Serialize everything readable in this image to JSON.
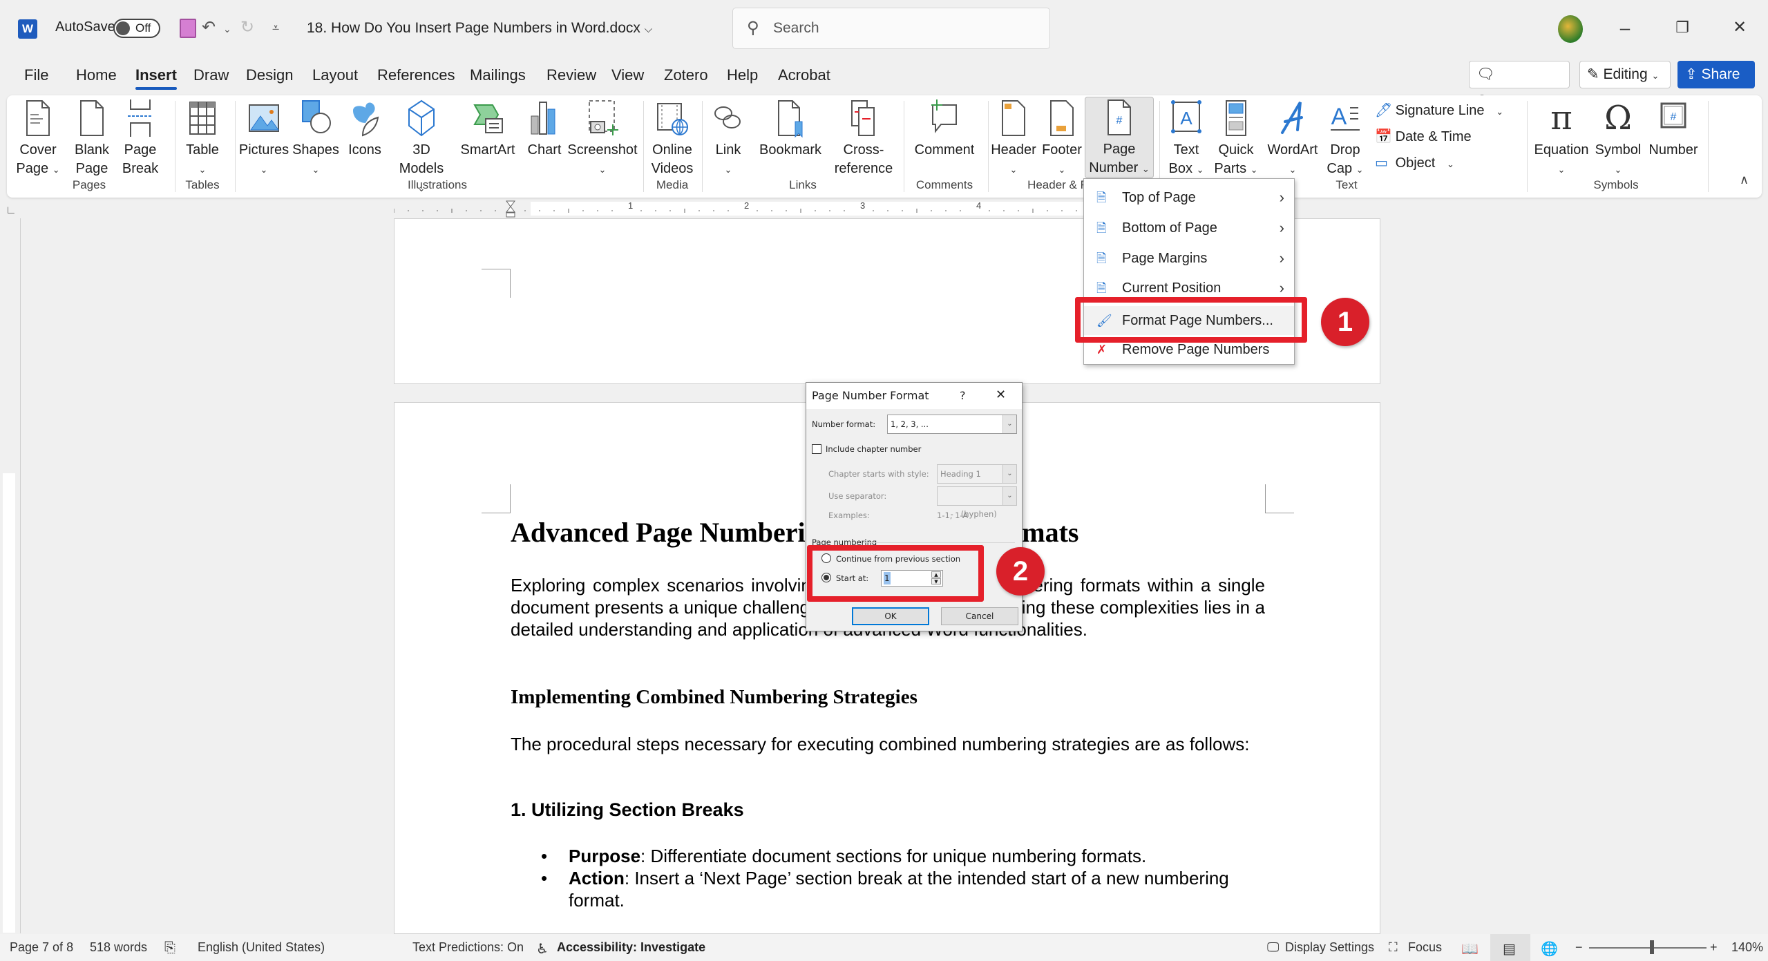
{
  "titlebar": {
    "app_icon": "word-icon",
    "app_letter": "W",
    "autosave_label": "AutoSave",
    "autosave_state": "Off",
    "doc_title": "18. How Do You Insert Page Numbers in Word.docx",
    "search_placeholder": "Search",
    "window_controls": {
      "minimize": "–",
      "restore": "❐",
      "close": "✕"
    }
  },
  "tabs": [
    "File",
    "Home",
    "Insert",
    "Draw",
    "Design",
    "Layout",
    "References",
    "Mailings",
    "Review",
    "View",
    "Zotero",
    "Help",
    "Acrobat"
  ],
  "active_tab": "Insert",
  "header_buttons": {
    "comments": "Comments",
    "editing": "Editing",
    "share": "Share"
  },
  "ribbon": {
    "groups": {
      "pages": "Pages",
      "tables": "Tables",
      "illustrations": "Illustrations",
      "media": "Media",
      "links": "Links",
      "comments": "Comments",
      "header_footer": "Header & F",
      "text": "Text",
      "symbols": "Symbols"
    },
    "buttons": {
      "cover_page": [
        "Cover",
        "Page"
      ],
      "blank_page": [
        "Blank",
        "Page"
      ],
      "page_break": [
        "Page",
        "Break"
      ],
      "table": [
        "Table",
        ""
      ],
      "pictures": [
        "Pictures",
        ""
      ],
      "shapes": [
        "Shapes",
        ""
      ],
      "icons": [
        "Icons",
        ""
      ],
      "models_3d": [
        "3D",
        "Models"
      ],
      "smartart": [
        "SmartArt",
        ""
      ],
      "chart": [
        "Chart",
        ""
      ],
      "screenshot": [
        "Screenshot",
        ""
      ],
      "online_videos": [
        "Online",
        "Videos"
      ],
      "link": [
        "Link",
        ""
      ],
      "bookmark": [
        "Bookmark",
        ""
      ],
      "cross_reference": [
        "Cross-",
        "reference"
      ],
      "comment": [
        "Comment",
        ""
      ],
      "header": [
        "Header",
        ""
      ],
      "footer": [
        "Footer",
        ""
      ],
      "page_number": [
        "Page",
        "Number"
      ],
      "text_box": [
        "Text",
        "Box"
      ],
      "quick_parts": [
        "Quick",
        "Parts"
      ],
      "wordart": [
        "WordArt",
        ""
      ],
      "drop_cap": [
        "Drop",
        "Cap"
      ],
      "equation": [
        "Equation",
        ""
      ],
      "symbol": [
        "Symbol",
        ""
      ],
      "number": [
        "Number",
        ""
      ]
    },
    "small_buttons": {
      "signature_line": "Signature Line",
      "date_time": "Date & Time",
      "object": "Object"
    }
  },
  "ruler": {
    "numbers": [
      "1",
      "2",
      "3",
      "4"
    ]
  },
  "page_number_menu": {
    "items": [
      {
        "label": "Top of Page",
        "has_submenu": true
      },
      {
        "label": "Bottom of Page",
        "has_submenu": true
      },
      {
        "label": "Page Margins",
        "has_submenu": true
      },
      {
        "label": "Current Position",
        "has_submenu": true
      },
      {
        "label": "Format Page Numbers...",
        "has_submenu": false,
        "highlighted": true
      },
      {
        "label": "Remove Page Numbers",
        "has_submenu": false
      }
    ]
  },
  "annotations": {
    "step1": "1",
    "step2": "2",
    "color": "#e5202a"
  },
  "dialog": {
    "title": "Page Number Format",
    "help": "?",
    "close": "✕",
    "number_format_label": "Number format:",
    "number_format_value": "1, 2, 3, ...",
    "include_chapter_label": "Include chapter number",
    "include_chapter_checked": false,
    "chapter_style_label": "Chapter starts with style:",
    "chapter_style_value": "Heading 1",
    "separator_label": "Use separator:",
    "separator_value": "-   (hyphen)",
    "examples_label": "Examples:",
    "examples_value": "1-1, 1-A",
    "page_numbering_label": "Page numbering",
    "continue_label": "Continue from previous section",
    "continue_selected": false,
    "start_at_label": "Start at:",
    "start_at_selected": true,
    "start_at_value": "1",
    "ok": "OK",
    "cancel": "Cancel"
  },
  "document": {
    "h1": "Advanced Page Numbering for Diverse Formats",
    "p1": "Exploring complex scenarios involving the use of multiple numbering formats within a single document presents a unique challenge. The essence of addressing these complexities lies in a detailed understanding and application of advanced Word functionalities.",
    "h2": "Implementing Combined Numbering Strategies",
    "p2": "The procedural steps necessary for executing combined numbering strategies are as follows:",
    "h3": "1. Utilizing Section Breaks",
    "bullets": [
      {
        "term": "Purpose",
        "text": ": Differentiate document sections for unique numbering formats."
      },
      {
        "term": "Action",
        "text": ": Insert a ‘Next Page’ section break at the intended start of a new numbering format."
      }
    ]
  },
  "statusbar": {
    "page": "Page 7 of 8",
    "words": "518 words",
    "language": "English (United States)",
    "text_predictions": "Text Predictions: On",
    "accessibility": "Accessibility: Investigate",
    "display_settings": "Display Settings",
    "focus": "Focus",
    "zoom_minus": "−",
    "zoom_plus": "+",
    "zoom_level": "140%"
  }
}
